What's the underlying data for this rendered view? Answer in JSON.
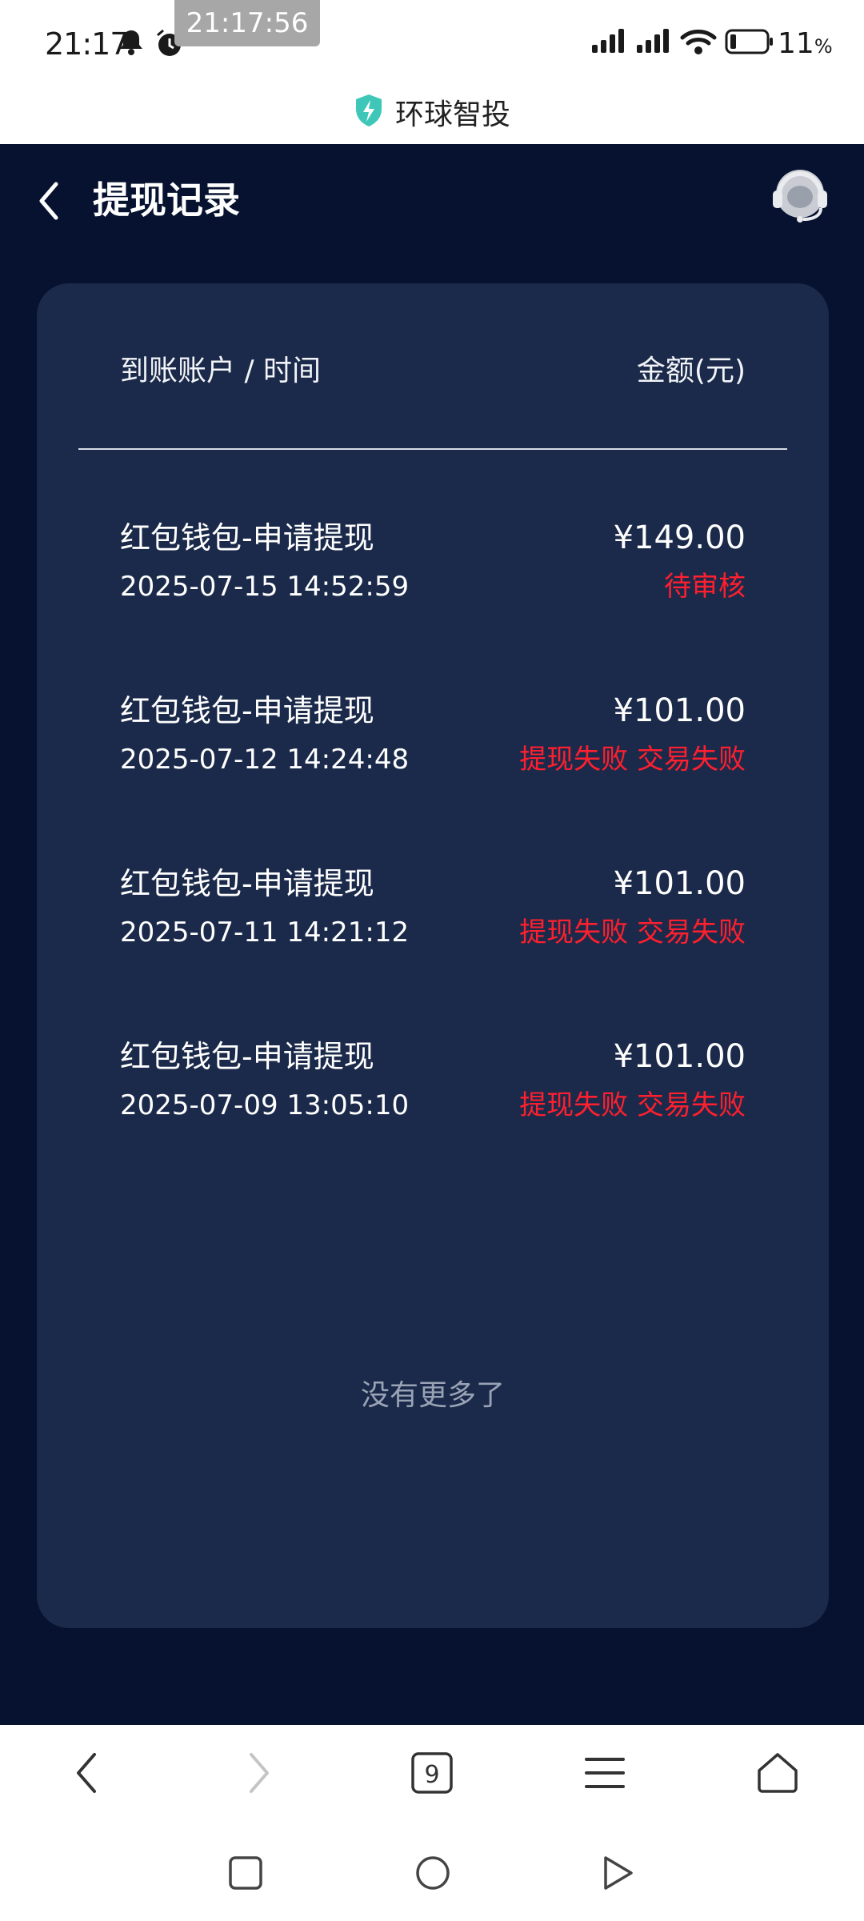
{
  "status_bar": {
    "time": "21:17",
    "clock_overlay": "21:17:56",
    "battery": "11",
    "battery_unit": "%"
  },
  "browser": {
    "site_title": "环球智投",
    "tab_count": "9"
  },
  "header": {
    "title": "提现记录"
  },
  "table": {
    "col_account_time": "到账账户 / 时间",
    "col_amount": "金额(元)",
    "records": [
      {
        "title": "红包钱包-申请提现",
        "time": "2025-07-15 14:52:59",
        "amount": "¥149.00",
        "status": "待审核"
      },
      {
        "title": "红包钱包-申请提现",
        "time": "2025-07-12 14:24:48",
        "amount": "¥101.00",
        "status": "提现失败 交易失败"
      },
      {
        "title": "红包钱包-申请提现",
        "time": "2025-07-11 14:21:12",
        "amount": "¥101.00",
        "status": "提现失败 交易失败"
      },
      {
        "title": "红包钱包-申请提现",
        "time": "2025-07-09 13:05:10",
        "amount": "¥101.00",
        "status": "提现失败 交易失败"
      }
    ],
    "no_more": "没有更多了"
  },
  "colors": {
    "app_background": "#06122f",
    "card_background": "#1b2a4a",
    "status_red": "#ff1f2e",
    "shield_teal": "#3ec7b8"
  },
  "icons": {
    "back": "chevron-left-icon",
    "support": "headset-icon",
    "site_logo": "shield-bolt-icon",
    "toolbar_back": "chevron-left-icon",
    "toolbar_forward": "chevron-right-icon",
    "toolbar_menu": "hamburger-icon",
    "toolbar_home": "home-icon"
  }
}
